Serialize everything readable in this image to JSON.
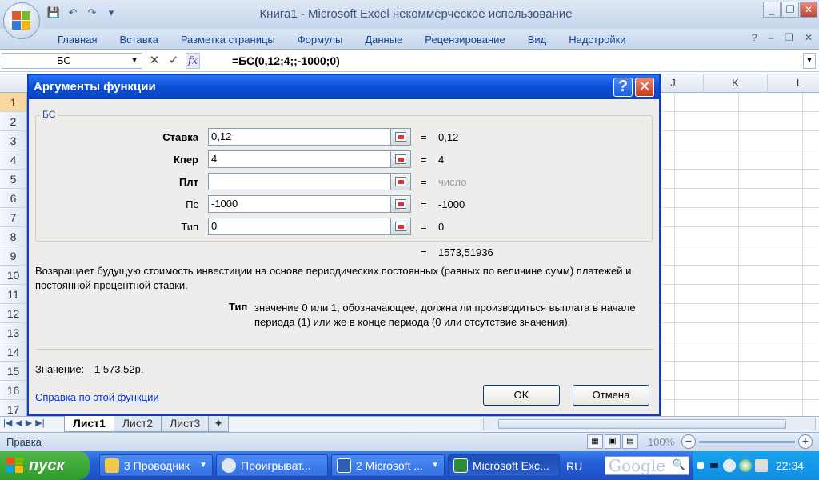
{
  "window": {
    "title": "Книга1 - Microsoft Excel некоммерческое использование",
    "minimize": "_",
    "restore": "❐",
    "close": "✕"
  },
  "qat": {
    "save_icon": "💾",
    "undo_icon": "↶",
    "redo_icon": "↷",
    "customize_icon": "▾"
  },
  "ribbon": {
    "tabs": [
      "Главная",
      "Вставка",
      "Разметка страницы",
      "Формулы",
      "Данные",
      "Рецензирование",
      "Вид",
      "Надстройки"
    ],
    "help_icon": "?",
    "min_icon": "–",
    "restore_icon": "❐",
    "close_icon": "✕"
  },
  "formula_bar": {
    "name_box": "БС",
    "cancel_icon": "✕",
    "enter_icon": "✓",
    "fx_label": "fx",
    "formula": "=БС(0,12;4;;-1000;0)"
  },
  "grid": {
    "columns": [
      "J",
      "K",
      "L"
    ],
    "rows": [
      "1",
      "2",
      "3",
      "4",
      "5",
      "6",
      "7",
      "8",
      "9",
      "10",
      "11",
      "12",
      "13",
      "14",
      "15",
      "16",
      "17"
    ],
    "selected_row": "1"
  },
  "sheets": {
    "tabs": [
      "Лист1",
      "Лист2",
      "Лист3"
    ],
    "active": "Лист1"
  },
  "status": {
    "text": "Правка",
    "zoom": "100%"
  },
  "dialog": {
    "title": "Аргументы функции",
    "help_label": "?",
    "close_label": "✕",
    "function_name": "БС",
    "args": [
      {
        "label": "Ставка",
        "value": "0,12",
        "result": "0,12",
        "required": true
      },
      {
        "label": "Кпер",
        "value": "4",
        "result": "4",
        "required": true
      },
      {
        "label": "Плт",
        "value": "",
        "result": "число",
        "required": true
      },
      {
        "label": "Пс",
        "value": "-1000",
        "result": "-1000",
        "required": false
      },
      {
        "label": "Тип",
        "value": "0",
        "result": "0",
        "required": false
      }
    ],
    "equals": "=",
    "total_result": "1573,51936",
    "description": "Возвращает будущую стоимость инвестиции на основе периодических постоянных (равных по величине сумм) платежей и постоянной процентной ставки.",
    "arg_help_name": "Тип",
    "arg_help_text": "значение 0 или 1, обозначающее, должна ли производиться выплата в начале периода (1) или же в конце периода (0 или отсутствие значения).",
    "value_label": "Значение:",
    "value": "1 573,52р.",
    "help_link": "Справка по этой функции",
    "ok": "OK",
    "cancel": "Отмена"
  },
  "taskbar": {
    "start": "пуск",
    "tasks": [
      {
        "label": "3 Проводник",
        "has_arrow": true
      },
      {
        "label": "Проигрыват...",
        "has_arrow": false
      },
      {
        "label": "2 Microsoft ...",
        "has_arrow": true
      },
      {
        "label": "Microsoft Exc...",
        "has_arrow": false
      }
    ],
    "lang": "RU",
    "search_text": "Google",
    "clock": "22:34"
  }
}
